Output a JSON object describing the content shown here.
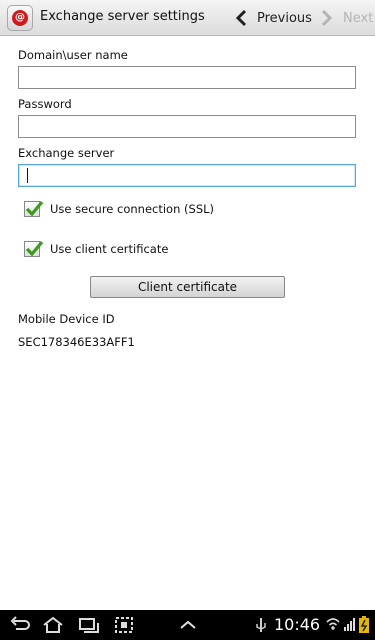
{
  "header": {
    "app_icon": "email-at-icon",
    "app_icon_glyph": "@",
    "title": "Exchange server settings",
    "previous_label": "Previous",
    "next_label": "Next"
  },
  "form": {
    "domain_user_label": "Domain\\user name",
    "domain_user_value": "",
    "password_label": "Password",
    "password_value": "",
    "server_label": "Exchange server",
    "server_value": "",
    "ssl_label": "Use secure connection (SSL)",
    "ssl_checked": true,
    "client_cert_label": "Use client certificate",
    "client_cert_checked": true,
    "client_cert_button": "Client certificate",
    "device_id_label": "Mobile Device ID",
    "device_id_value": "SEC178346E33AFF1"
  },
  "statusbar": {
    "time": "10:46",
    "icons": [
      "back-icon",
      "home-icon",
      "recent-apps-icon",
      "screenshot-icon",
      "up-chevron-icon",
      "usb-icon",
      "wifi-icon",
      "signal-icon",
      "battery-icon"
    ]
  },
  "colors": {
    "accent_focus": "#56a4dc",
    "check_green": "#3c9a1e",
    "app_icon_red": "#cf1b1b"
  }
}
